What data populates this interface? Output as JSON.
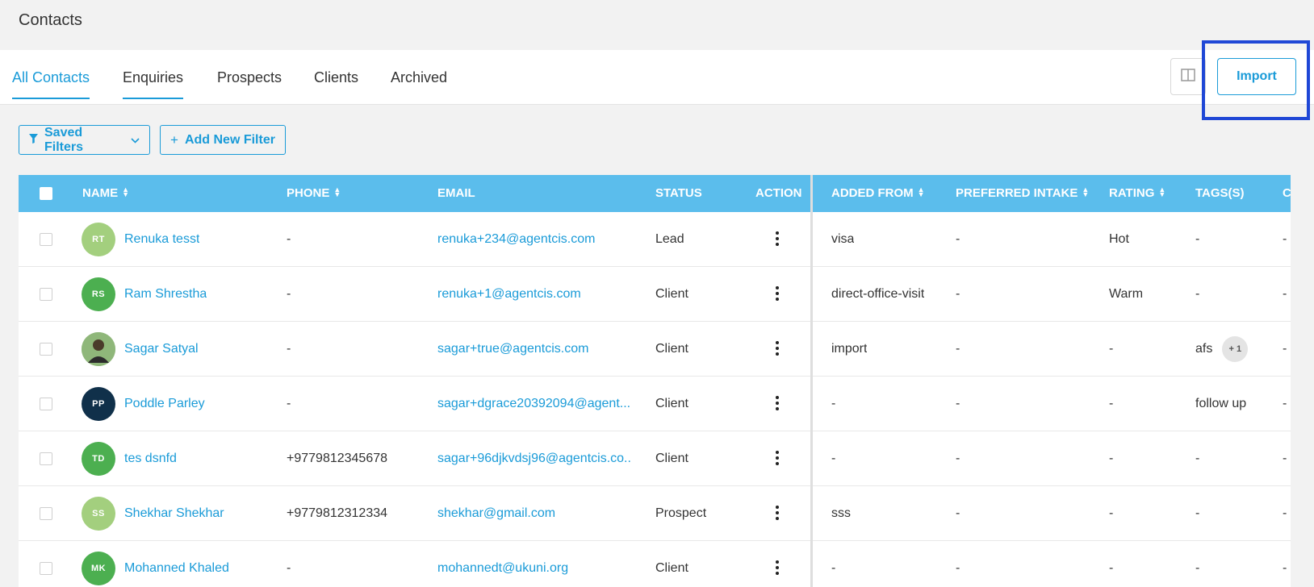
{
  "page": {
    "title": "Contacts"
  },
  "tabs": [
    {
      "label": "All Contacts"
    },
    {
      "label": "Enquiries"
    },
    {
      "label": "Prospects"
    },
    {
      "label": "Clients"
    },
    {
      "label": "Archived"
    }
  ],
  "toolbar": {
    "import_label": "Import",
    "columns_icon": "columns-icon"
  },
  "filters": {
    "saved_label": "Saved Filters",
    "add_label": "Add New Filter"
  },
  "table": {
    "headers": {
      "name": "NAME",
      "phone": "PHONE",
      "email": "EMAIL",
      "status": "STATUS",
      "action": "ACTION",
      "added_from": "ADDED FROM",
      "preferred_intake": "PREFERRED INTAKE",
      "rating": "RATING",
      "tags": "TAGS(S)",
      "next": "C"
    },
    "rows": [
      {
        "initials": "RT",
        "avatar_color": "#a3cf7e",
        "name": "Renuka tesst",
        "phone": "-",
        "email": "renuka+234@agentcis.com",
        "status": "Lead",
        "added_from": "visa",
        "intake": "-",
        "rating": "Hot",
        "tags": "-",
        "next": "-"
      },
      {
        "initials": "RS",
        "avatar_color": "#4caf50",
        "name": "Ram Shrestha",
        "phone": "-",
        "email": "renuka+1@agentcis.com",
        "status": "Client",
        "added_from": "direct-office-visit",
        "intake": "-",
        "rating": "Warm",
        "tags": "-",
        "next": "-"
      },
      {
        "initials": "",
        "avatar_color": "#8fb77a",
        "name": "Sagar Satyal",
        "phone": "-",
        "email": "sagar+true@agentcis.com",
        "status": "Client",
        "added_from": "import",
        "intake": "-",
        "rating": "-",
        "tags": "afs",
        "tag_count": "+ 1",
        "next": "-"
      },
      {
        "initials": "PP",
        "avatar_color": "#10304a",
        "name": "Poddle Parley",
        "phone": "-",
        "email": "sagar+dgrace20392094@agent...",
        "status": "Client",
        "added_from": "-",
        "intake": "-",
        "rating": "-",
        "tags": "follow up",
        "next": "-"
      },
      {
        "initials": "TD",
        "avatar_color": "#4caf50",
        "name": "tes dsnfd",
        "phone": "+9779812345678",
        "email": "sagar+96djkvdsj96@agentcis.co...",
        "status": "Client",
        "added_from": "-",
        "intake": "-",
        "rating": "-",
        "tags": "-",
        "next": "-"
      },
      {
        "initials": "SS",
        "avatar_color": "#a3cf7e",
        "name": "Shekhar Shekhar",
        "phone": "+9779812312334",
        "email": "shekhar@gmail.com",
        "status": "Prospect",
        "added_from": "sss",
        "intake": "-",
        "rating": "-",
        "tags": "-",
        "next": "-"
      },
      {
        "initials": "MK",
        "avatar_color": "#4caf50",
        "name": "Mohanned Khaled",
        "phone": "-",
        "email": "mohannedt@ukuni.org",
        "status": "Client",
        "added_from": "-",
        "intake": "-",
        "rating": "-",
        "tags": "-",
        "next": "-"
      }
    ]
  }
}
